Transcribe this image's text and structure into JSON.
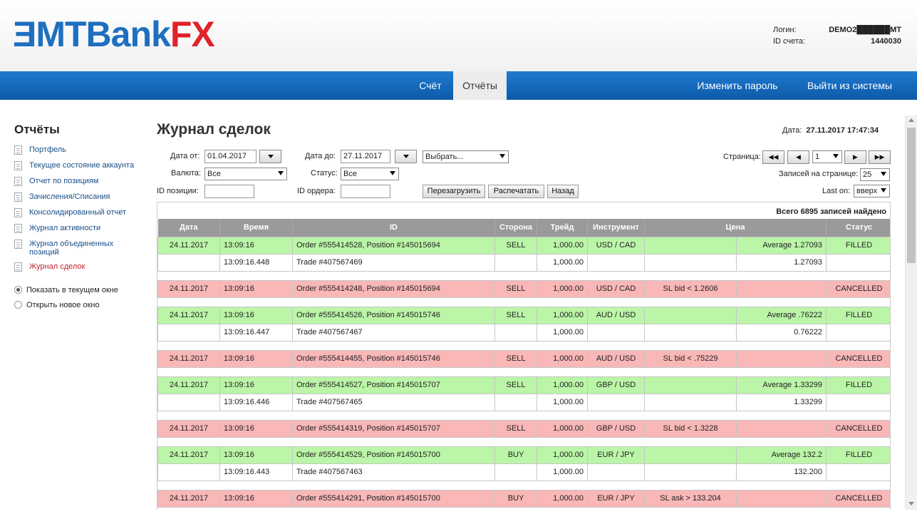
{
  "logo": {
    "mtb": "ƎMTBank",
    "fx": "FX"
  },
  "account": {
    "login_label": "Логин:",
    "login_value": "DEMO2██████MT",
    "id_label": "ID счета:",
    "id_value": "1440030"
  },
  "nav": {
    "account": "Счёт",
    "reports": "Отчёты",
    "change_password": "Изменить пароль",
    "logout": "Выйти из системы"
  },
  "sidebar": {
    "title": "Отчёты",
    "items": [
      "Портфель",
      "Текущее состояние аккаунта",
      "Отчет по позициям",
      "Зачисления/Списания",
      "Консолидированный отчет",
      "Журнал активности",
      "Журнал объединенных позиций",
      "Журнал сделок"
    ],
    "radio_current": "Показать в текущем окне",
    "radio_new": "Открыть новое окно"
  },
  "page": {
    "title": "Журнал сделок",
    "date_label": "Дата:",
    "date_value": "27.11.2017 17:47:34"
  },
  "filters": {
    "date_from_label": "Дата от:",
    "date_from": "01.04.2017",
    "date_to_label": "Дата до:",
    "date_to": "27.11.2017",
    "choose": "Выбрать...",
    "currency_label": "Валюта:",
    "currency": "Все",
    "status_label": "Статус:",
    "status": "Все",
    "position_id_label": "ID позиции:",
    "order_id_label": "ID ордера:",
    "reload": "Перезагрузить",
    "print": "Распечатать",
    "back": "Назад"
  },
  "paging": {
    "page_label": "Страница:",
    "page": "1",
    "first": "◀◀",
    "prev": "◀",
    "next": "▶",
    "last": "▶▶",
    "per_page_label": "Записей на странице:",
    "per_page": "25",
    "last_on_label": "Last on:",
    "last_on": "вверх"
  },
  "table": {
    "total": "Всего 6895 записей найдено",
    "headers": [
      "Дата",
      "Время",
      "ID",
      "Сторона",
      "Трейд",
      "Инструмент",
      "Цена",
      "Статус"
    ],
    "rows": [
      {
        "type": "green",
        "date": "24.11.2017",
        "time": "13:09:16",
        "id": "Order #555414528, Position #145015694",
        "side": "SELL",
        "trade": "1,000.00",
        "instrument": "USD / CAD",
        "price_a": "",
        "price_b": "Average 1.27093",
        "status": "FILLED"
      },
      {
        "type": "sub",
        "date": "",
        "time": "13:09:16.448",
        "id": "Trade #407567469",
        "side": "",
        "trade": "1,000.00",
        "instrument": "",
        "price_a": "",
        "price_b": "1.27093",
        "status": ""
      },
      {
        "type": "gap"
      },
      {
        "type": "red",
        "date": "24.11.2017",
        "time": "13:09:16",
        "id": "Order #555414248, Position #145015694",
        "side": "SELL",
        "trade": "1,000.00",
        "instrument": "USD / CAD",
        "price_a": "SL bid < 1.2606",
        "price_b": "",
        "status": "CANCELLED"
      },
      {
        "type": "gap"
      },
      {
        "type": "green",
        "date": "24.11.2017",
        "time": "13:09:16",
        "id": "Order #555414526, Position #145015746",
        "side": "SELL",
        "trade": "1,000.00",
        "instrument": "AUD / USD",
        "price_a": "",
        "price_b": "Average .76222",
        "status": "FILLED"
      },
      {
        "type": "sub",
        "date": "",
        "time": "13:09:16.447",
        "id": "Trade #407567467",
        "side": "",
        "trade": "1,000.00",
        "instrument": "",
        "price_a": "",
        "price_b": "0.76222",
        "status": ""
      },
      {
        "type": "gap"
      },
      {
        "type": "red",
        "date": "24.11.2017",
        "time": "13:09:16",
        "id": "Order #555414455, Position #145015746",
        "side": "SELL",
        "trade": "1,000.00",
        "instrument": "AUD / USD",
        "price_a": "SL bid < .75229",
        "price_b": "",
        "status": "CANCELLED"
      },
      {
        "type": "gap"
      },
      {
        "type": "green",
        "date": "24.11.2017",
        "time": "13:09:16",
        "id": "Order #555414527, Position #145015707",
        "side": "SELL",
        "trade": "1,000.00",
        "instrument": "GBP / USD",
        "price_a": "",
        "price_b": "Average 1.33299",
        "status": "FILLED"
      },
      {
        "type": "sub",
        "date": "",
        "time": "13:09:16.446",
        "id": "Trade #407567465",
        "side": "",
        "trade": "1,000.00",
        "instrument": "",
        "price_a": "",
        "price_b": "1.33299",
        "status": ""
      },
      {
        "type": "gap"
      },
      {
        "type": "red",
        "date": "24.11.2017",
        "time": "13:09:16",
        "id": "Order #555414319, Position #145015707",
        "side": "SELL",
        "trade": "1,000.00",
        "instrument": "GBP / USD",
        "price_a": "SL bid < 1.3228",
        "price_b": "",
        "status": "CANCELLED"
      },
      {
        "type": "gap"
      },
      {
        "type": "green",
        "date": "24.11.2017",
        "time": "13:09:16",
        "id": "Order #555414529, Position #145015700",
        "side": "BUY",
        "trade": "1,000.00",
        "instrument": "EUR / JPY",
        "price_a": "",
        "price_b": "Average 132.2",
        "status": "FILLED"
      },
      {
        "type": "sub",
        "date": "",
        "time": "13:09:16.443",
        "id": "Trade #407567463",
        "side": "",
        "trade": "1,000.00",
        "instrument": "",
        "price_a": "",
        "price_b": "132.200",
        "status": ""
      },
      {
        "type": "gap"
      },
      {
        "type": "red",
        "date": "24.11.2017",
        "time": "13:09:16",
        "id": "Order #555414291, Position #145015700",
        "side": "BUY",
        "trade": "1,000.00",
        "instrument": "EUR / JPY",
        "price_a": "SL ask > 133.204",
        "price_b": "",
        "status": "CANCELLED"
      }
    ]
  }
}
